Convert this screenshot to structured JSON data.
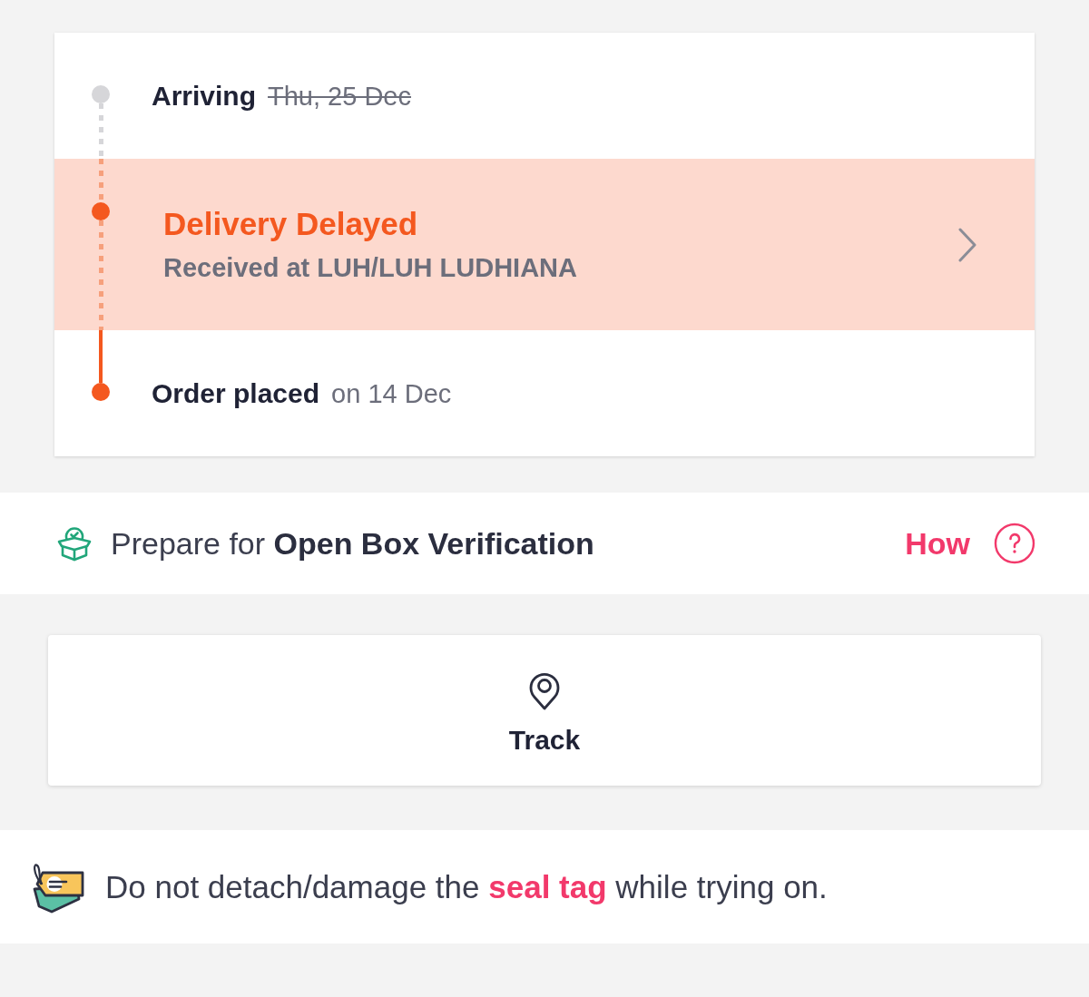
{
  "timeline": {
    "steps": [
      {
        "kind": "inline",
        "reached": false,
        "completed": false,
        "title": "Arriving",
        "detail": "Thu, 25 Dec",
        "struck": true
      },
      {
        "kind": "alert",
        "reached": true,
        "completed": false,
        "title": "Delivery Delayed",
        "detail": "Received at LUH/LUH LUDHIANA",
        "struck": false
      },
      {
        "kind": "inline",
        "reached": true,
        "completed": true,
        "title": "Order placed",
        "detail": "on 14 Dec",
        "struck": false
      }
    ]
  },
  "verification": {
    "prompt": "Prepare for **Open Box Verification**",
    "link": "How"
  },
  "track": {
    "label": "Track"
  },
  "seal_note": {
    "before": "Do not detach/damage the",
    "link": "seal tag",
    "after": "while trying on."
  }
}
